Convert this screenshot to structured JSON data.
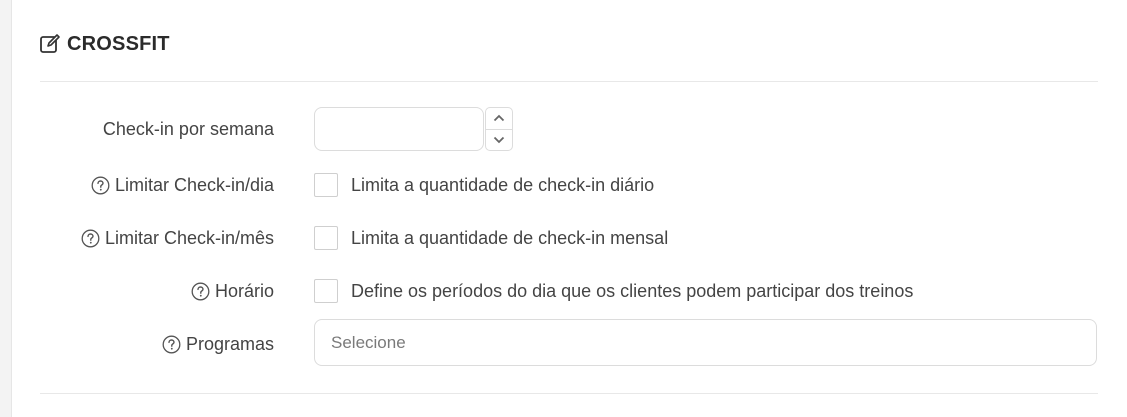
{
  "section": {
    "title": "CROSSFIT",
    "icon": "edit-icon"
  },
  "fields": {
    "checkin_week": {
      "label": "Check-in por semana",
      "value": ""
    },
    "limit_day": {
      "label": "Limitar Check-in/dia",
      "description": "Limita a quantidade de check-in diário",
      "checked": false
    },
    "limit_month": {
      "label": "Limitar Check-in/mês",
      "description": "Limita a quantidade de check-in mensal",
      "checked": false
    },
    "schedule": {
      "label": "Horário",
      "description": "Define os períodos do dia que os clientes podem participar dos treinos",
      "checked": false
    },
    "programs": {
      "label": "Programas",
      "placeholder": "Selecione"
    }
  },
  "colors": {
    "border": "#dcdcdc",
    "text": "#444444",
    "title": "#2b2b2b"
  }
}
